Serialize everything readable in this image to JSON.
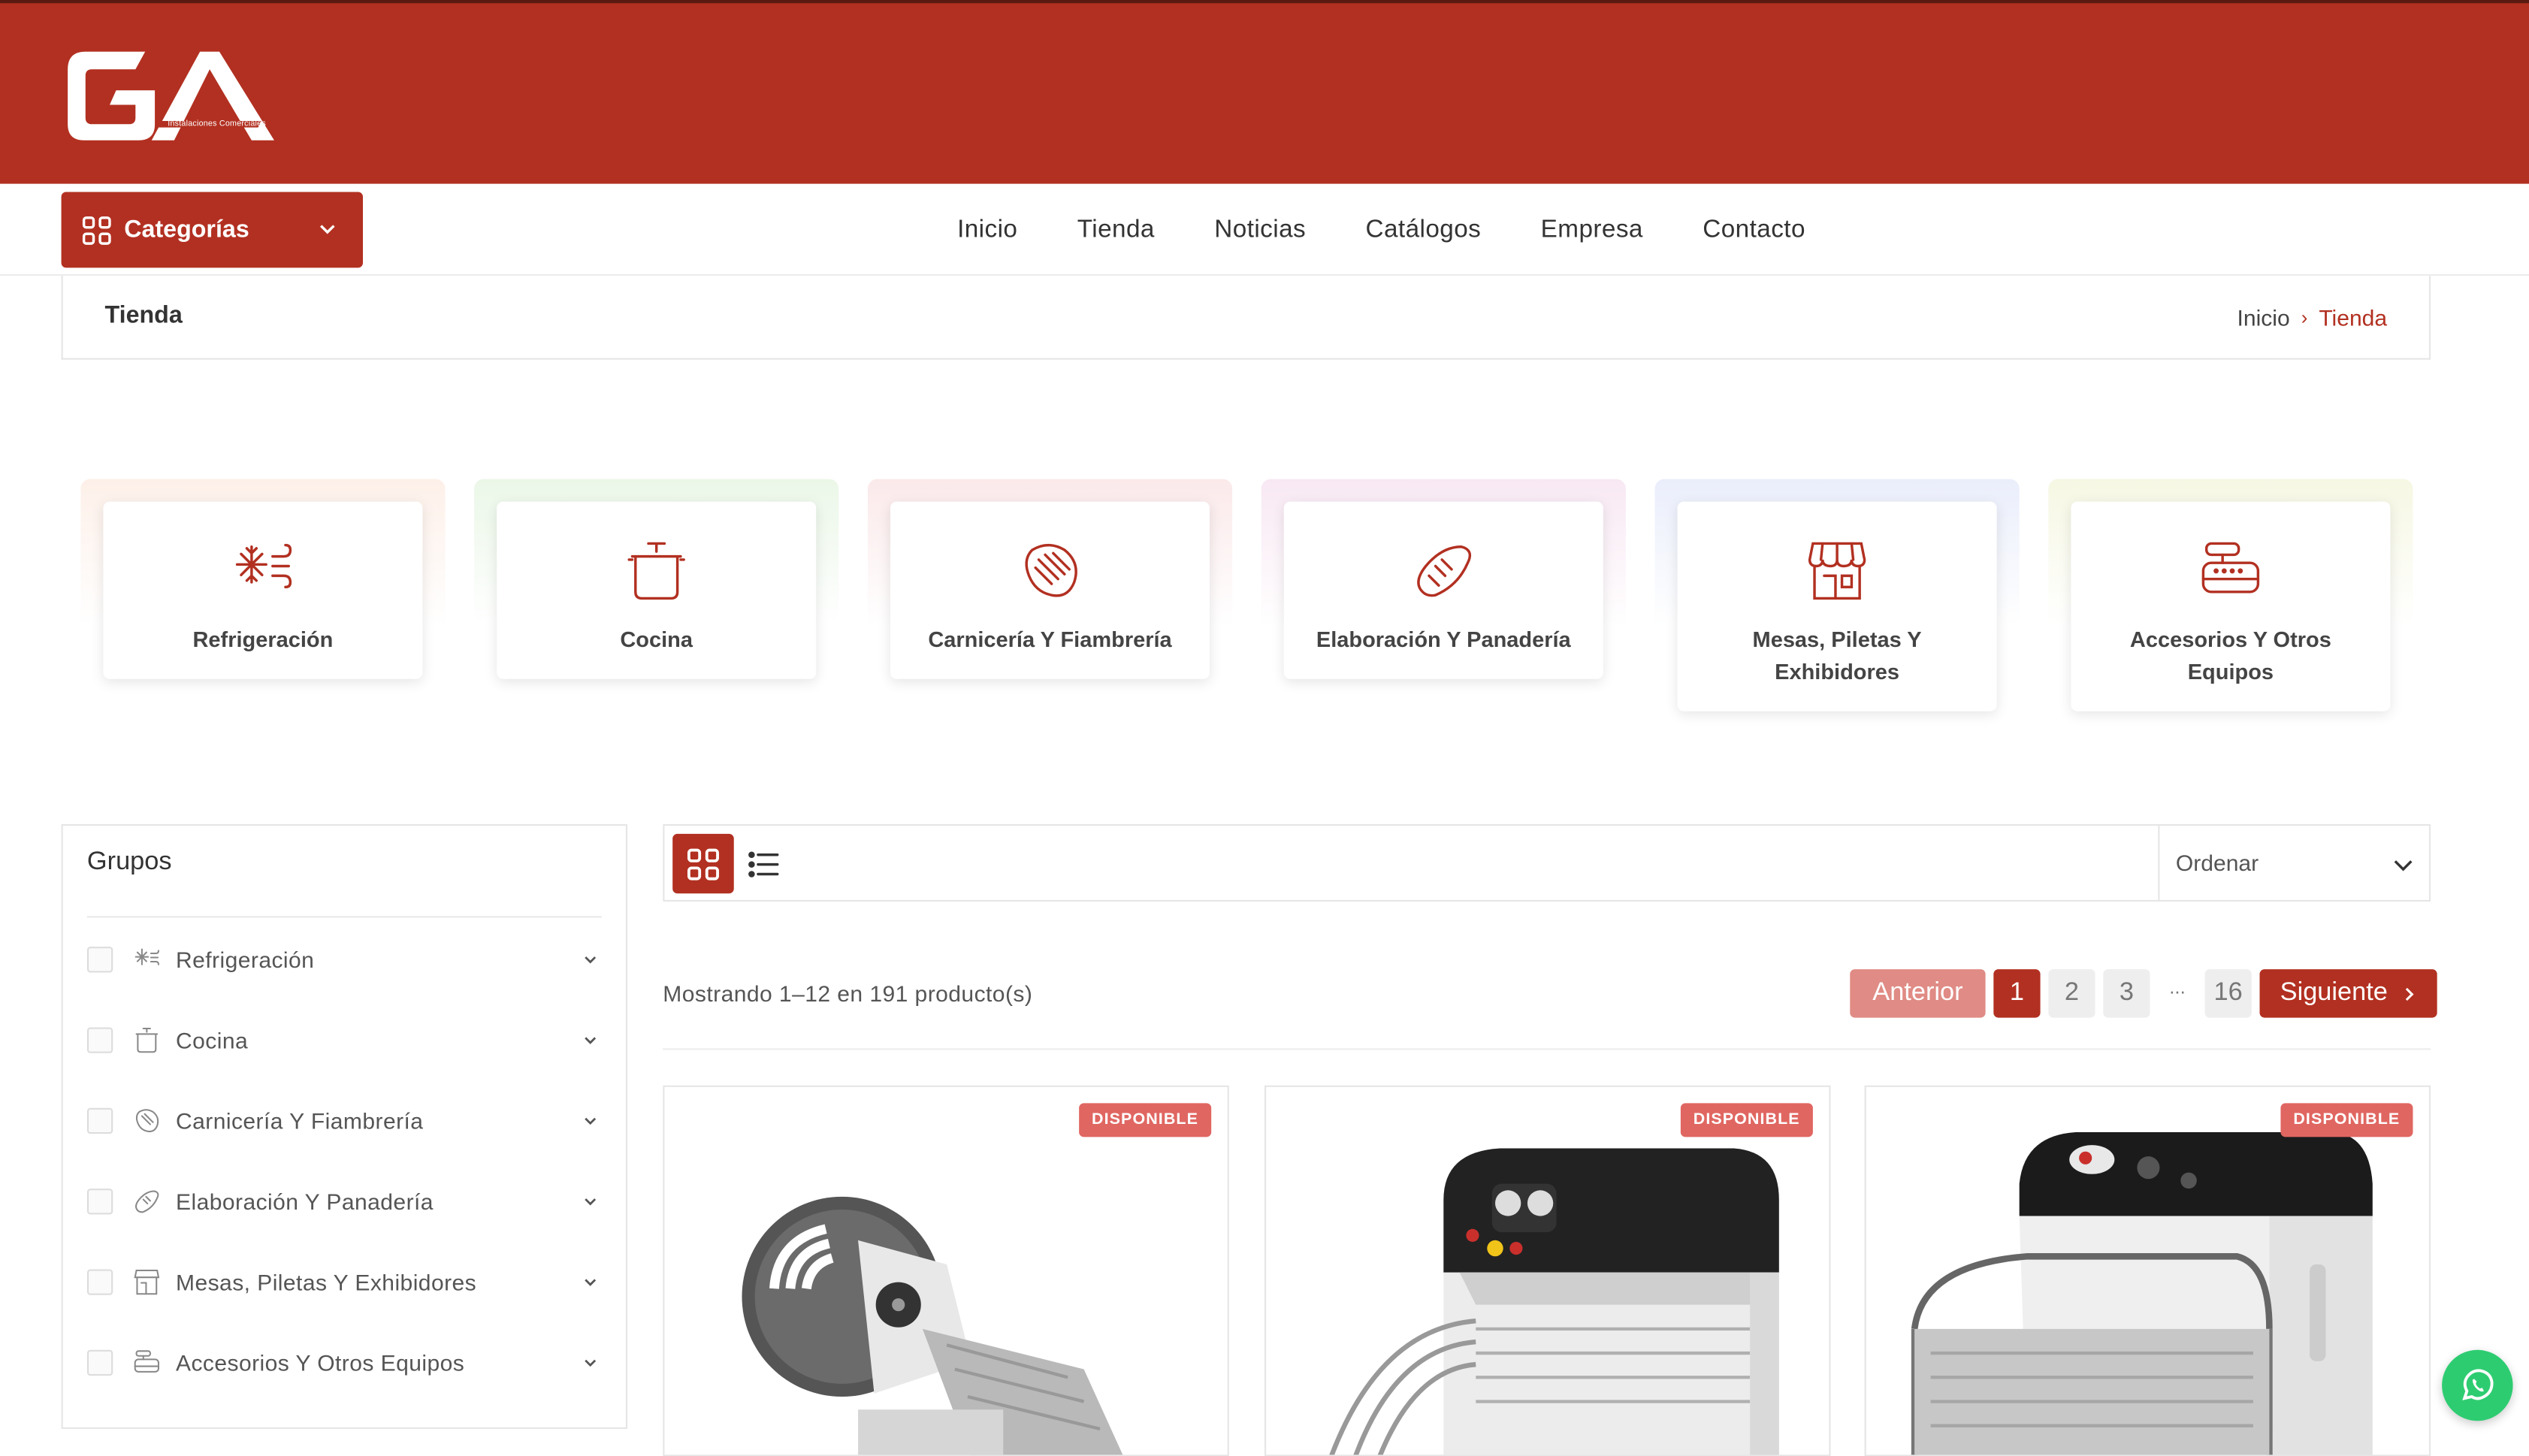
{
  "brand": {
    "logo_text": "GA",
    "tagline": "Instalaciones Comerciales",
    "color": "#b23021"
  },
  "nav": {
    "categories_label": "Categorías",
    "items": [
      "Inicio",
      "Tienda",
      "Noticias",
      "Catálogos",
      "Empresa",
      "Contacto"
    ]
  },
  "page": {
    "title": "Tienda",
    "breadcrumb_home": "Inicio",
    "breadcrumb_sep": "›",
    "breadcrumb_current": "Tienda"
  },
  "categories": [
    {
      "label": "Refrigeración",
      "icon": "snowflake-icon"
    },
    {
      "label": "Cocina",
      "icon": "pot-icon"
    },
    {
      "label": "Carnicería Y Fiambrería",
      "icon": "steak-icon"
    },
    {
      "label": "Elaboración Y Panadería",
      "icon": "bread-icon"
    },
    {
      "label": "Mesas, Piletas Y Exhibidores",
      "icon": "store-icon"
    },
    {
      "label": "Accesorios Y Otros Equipos",
      "icon": "scale-icon"
    }
  ],
  "sidebar": {
    "title": "Grupos",
    "items": [
      {
        "label": "Refrigeración",
        "icon": "snowflake-icon"
      },
      {
        "label": "Cocina",
        "icon": "pot-icon"
      },
      {
        "label": "Carnicería Y Fiambrería",
        "icon": "steak-icon"
      },
      {
        "label": "Elaboración Y Panadería",
        "icon": "bread-icon"
      },
      {
        "label": "Mesas, Piletas Y Exhibidores",
        "icon": "store-icon"
      },
      {
        "label": "Accesorios Y Otros Equipos",
        "icon": "scale-icon"
      }
    ]
  },
  "toolbar": {
    "sort_label": "Ordenar"
  },
  "results": {
    "summary": "Mostrando 1–12 en 191 producto(s)"
  },
  "pagination": {
    "prev": "Anterior",
    "pages": [
      "1",
      "2",
      "3"
    ],
    "ellipsis": "...",
    "last": "16",
    "current": "1",
    "next": "Siguiente"
  },
  "products": [
    {
      "badge": "DISPONIBLE",
      "image": "tilting-spiral-mixer"
    },
    {
      "badge": "DISPONIBLE",
      "image": "spiral-mixer-black-head"
    },
    {
      "badge": "DISPONIBLE",
      "image": "spiral-mixer-glossy-black"
    }
  ],
  "colors": {
    "accent": "#b23021",
    "prev_button": "#e08b85",
    "badge": "#e06661",
    "whatsapp": "#2ecc71"
  }
}
